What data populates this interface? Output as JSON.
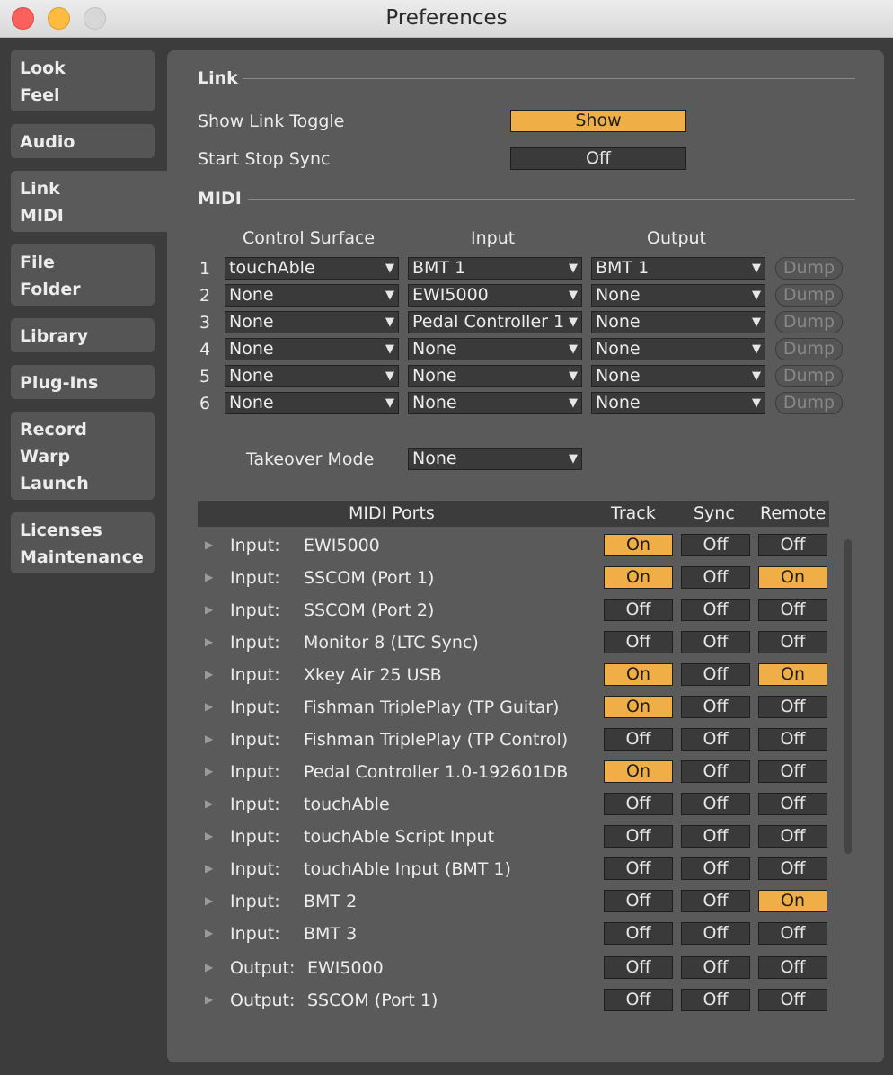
{
  "window": {
    "title": "Preferences"
  },
  "sidebar": {
    "tabs": [
      {
        "lines": [
          "Look",
          "Feel"
        ]
      },
      {
        "lines": [
          "Audio"
        ]
      },
      {
        "lines": [
          "Link",
          "MIDI"
        ]
      },
      {
        "lines": [
          "File",
          "Folder"
        ]
      },
      {
        "lines": [
          "Library"
        ]
      },
      {
        "lines": [
          "Plug-Ins"
        ]
      },
      {
        "lines": [
          "Record",
          "Warp",
          "Launch"
        ]
      },
      {
        "lines": [
          "Licenses",
          "Maintenance"
        ]
      }
    ]
  },
  "link": {
    "title": "Link",
    "show_toggle_label": "Show Link Toggle",
    "show_toggle_value": "Show",
    "start_stop_label": "Start Stop Sync",
    "start_stop_value": "Off"
  },
  "midi": {
    "title": "MIDI",
    "headers": {
      "surface": "Control Surface",
      "input": "Input",
      "output": "Output"
    },
    "rows": [
      {
        "num": "1",
        "surface": "touchAble",
        "input": "BMT 1",
        "output": "BMT 1",
        "dump": "Dump"
      },
      {
        "num": "2",
        "surface": "None",
        "input": "EWI5000",
        "output": "None",
        "dump": "Dump"
      },
      {
        "num": "3",
        "surface": "None",
        "input": "Pedal Controller 1",
        "output": "None",
        "dump": "Dump"
      },
      {
        "num": "4",
        "surface": "None",
        "input": "None",
        "output": "None",
        "dump": "Dump"
      },
      {
        "num": "5",
        "surface": "None",
        "input": "None",
        "output": "None",
        "dump": "Dump"
      },
      {
        "num": "6",
        "surface": "None",
        "input": "None",
        "output": "None",
        "dump": "Dump"
      }
    ],
    "takeover_label": "Takeover Mode",
    "takeover_value": "None"
  },
  "ports": {
    "headers": {
      "name": "MIDI Ports",
      "track": "Track",
      "sync": "Sync",
      "remote": "Remote"
    },
    "rows": [
      {
        "type": "Input:",
        "name": "EWI5000",
        "track": "On",
        "sync": "Off",
        "remote": "Off"
      },
      {
        "type": "Input:",
        "name": "SSCOM (Port 1)",
        "track": "On",
        "sync": "Off",
        "remote": "On"
      },
      {
        "type": "Input:",
        "name": "SSCOM (Port 2)",
        "track": "Off",
        "sync": "Off",
        "remote": "Off"
      },
      {
        "type": "Input:",
        "name": "Monitor 8 (LTC Sync)",
        "track": "Off",
        "sync": "Off",
        "remote": "Off"
      },
      {
        "type": "Input:",
        "name": "Xkey Air 25 USB",
        "track": "On",
        "sync": "Off",
        "remote": "On"
      },
      {
        "type": "Input:",
        "name": "Fishman TriplePlay (TP Guitar)",
        "track": "On",
        "sync": "Off",
        "remote": "Off"
      },
      {
        "type": "Input:",
        "name": "Fishman TriplePlay (TP Control)",
        "track": "Off",
        "sync": "Off",
        "remote": "Off"
      },
      {
        "type": "Input:",
        "name": "Pedal Controller 1.0-192601DB",
        "track": "On",
        "sync": "Off",
        "remote": "Off"
      },
      {
        "type": "Input:",
        "name": "touchAble",
        "track": "Off",
        "sync": "Off",
        "remote": "Off"
      },
      {
        "type": "Input:",
        "name": "touchAble Script Input",
        "track": "Off",
        "sync": "Off",
        "remote": "Off"
      },
      {
        "type": "Input:",
        "name": "touchAble Input (BMT 1)",
        "track": "Off",
        "sync": "Off",
        "remote": "Off"
      },
      {
        "type": "Input:",
        "name": "BMT 2",
        "track": "Off",
        "sync": "Off",
        "remote": "On"
      },
      {
        "type": "Input:",
        "name": "BMT 3",
        "track": "Off",
        "sync": "Off",
        "remote": "Off"
      },
      {
        "type": "Output:",
        "name": "EWI5000",
        "track": "Off",
        "sync": "Off",
        "remote": "Off"
      },
      {
        "type": "Output:",
        "name": "SSCOM (Port 1)",
        "track": "Off",
        "sync": "Off",
        "remote": "Off"
      }
    ]
  },
  "icons": {
    "expand": "triangle-right-icon",
    "dropdown": "triangle-down-icon"
  },
  "colors": {
    "accent": "#f0ae47"
  }
}
